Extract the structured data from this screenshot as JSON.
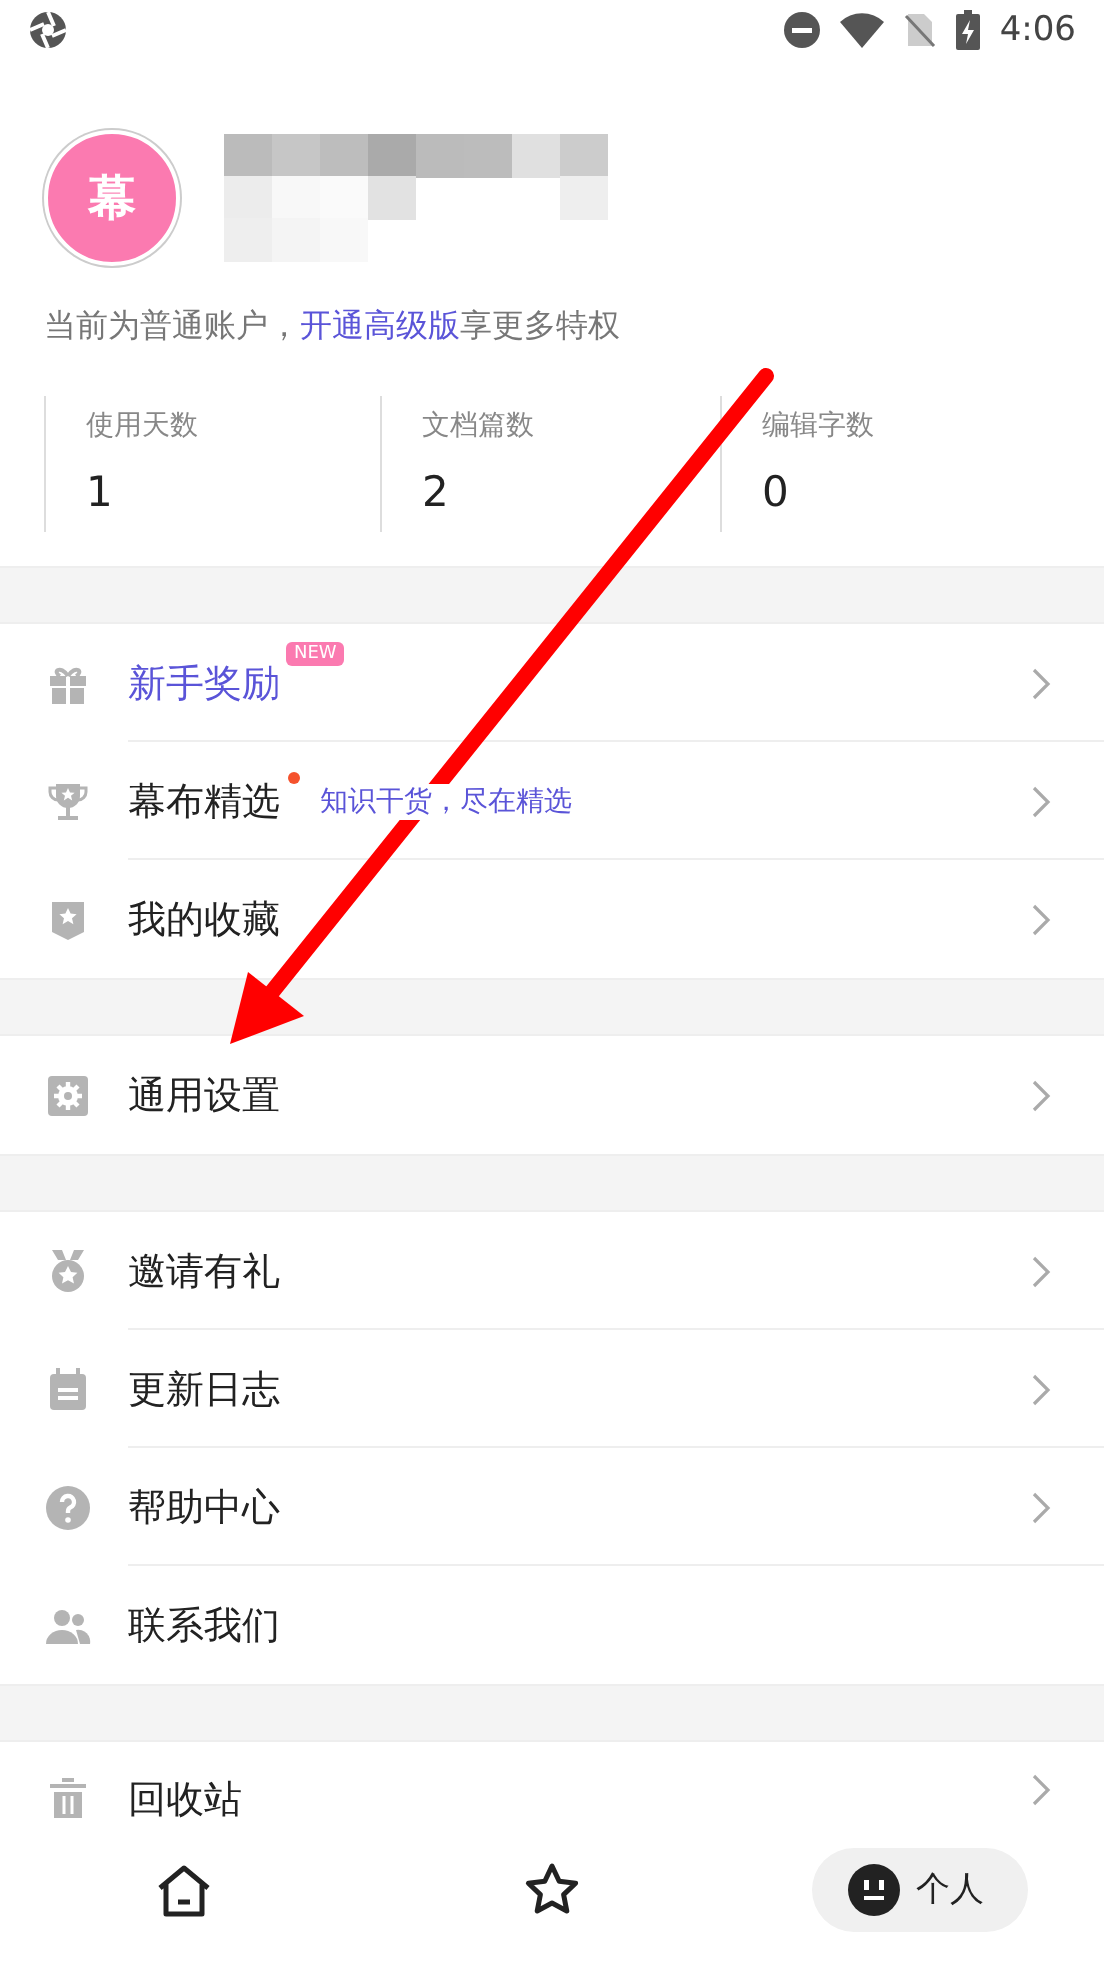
{
  "status_bar": {
    "time": "4:06"
  },
  "profile": {
    "avatar_text": "幕",
    "account_prefix": "当前为普通账户，",
    "upgrade_link": "开通高级版",
    "account_suffix": "享更多特权"
  },
  "stats": [
    {
      "label": "使用天数",
      "value": "1"
    },
    {
      "label": "文档篇数",
      "value": "2"
    },
    {
      "label": "编辑字数",
      "value": "0"
    }
  ],
  "menu_groups": [
    {
      "items": [
        {
          "label": "新手奖励",
          "accent": true,
          "badge": "NEW",
          "chevron": true
        },
        {
          "label": "幕布精选",
          "accent": false,
          "dot": true,
          "subtitle": "知识干货，尽在精选",
          "chevron": true
        },
        {
          "label": "我的收藏",
          "accent": false,
          "chevron": true
        }
      ]
    },
    {
      "items": [
        {
          "label": "通用设置",
          "accent": false,
          "chevron": true
        }
      ]
    },
    {
      "items": [
        {
          "label": "邀请有礼",
          "accent": false,
          "chevron": true
        },
        {
          "label": "更新日志",
          "accent": false,
          "chevron": true
        },
        {
          "label": "帮助中心",
          "accent": false,
          "chevron": true
        },
        {
          "label": "联系我们",
          "accent": false,
          "chevron": false
        }
      ]
    },
    {
      "items": [
        {
          "label": "回收站",
          "accent": false,
          "chevron": true
        }
      ]
    }
  ],
  "bottom_nav": [
    {
      "selected": false
    },
    {
      "selected": false
    },
    {
      "label": "个人",
      "selected": true
    }
  ]
}
